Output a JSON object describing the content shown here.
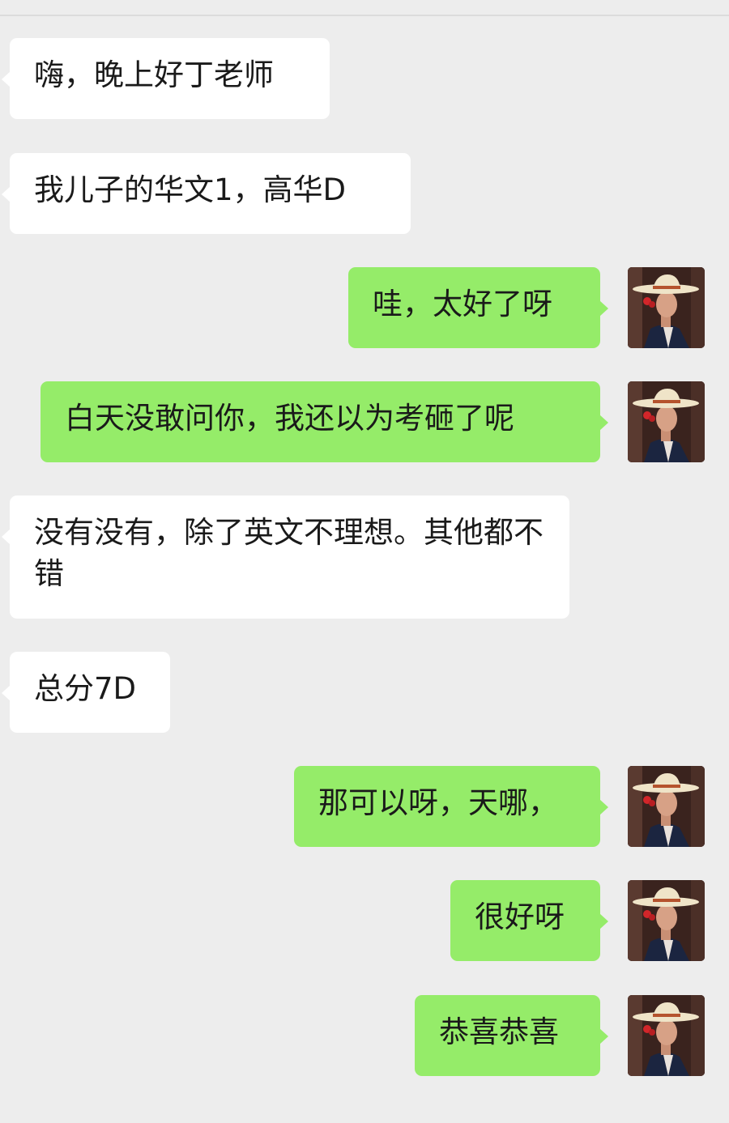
{
  "messages": [
    {
      "side": "in",
      "text": "嗨，晚上好丁老师"
    },
    {
      "side": "in",
      "text": "我儿子的华文1，高华D"
    },
    {
      "side": "out",
      "text": "哇，太好了呀"
    },
    {
      "side": "out",
      "text": "白天没敢问你，我还以为考砸了呢"
    },
    {
      "side": "in",
      "text": "没有没有，除了英文不理想。其他都不错"
    },
    {
      "side": "in",
      "text": "总分7D"
    },
    {
      "side": "out",
      "text": "那可以呀，天哪，"
    },
    {
      "side": "out",
      "text": "很好呀"
    },
    {
      "side": "out",
      "text": "恭喜恭喜"
    }
  ],
  "colors": {
    "background": "#ededed",
    "incoming_bubble": "#ffffff",
    "outgoing_bubble": "#95ec69",
    "text": "#1a1a1a"
  },
  "icons": {
    "avatar": "user-avatar-woman-in-cowboy-hat"
  }
}
